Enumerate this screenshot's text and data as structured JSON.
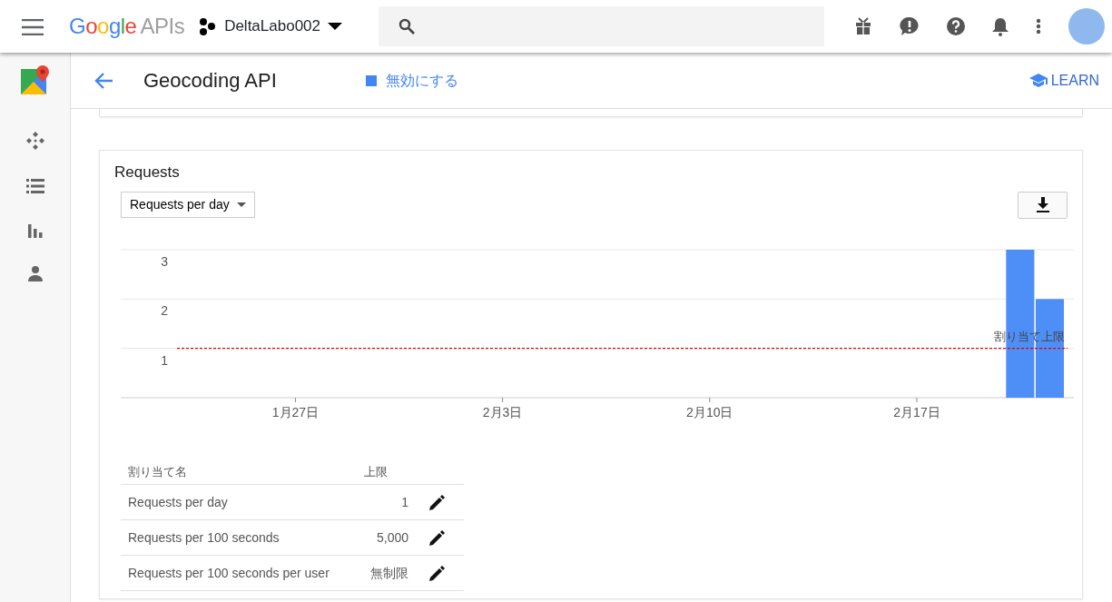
{
  "header": {
    "logo": "Google",
    "logo_suffix": "APIs",
    "project": "DeltaLabo002"
  },
  "subheader": {
    "title": "Geocoding API",
    "disable": "無効にする",
    "learn": "LEARN"
  },
  "requests_card": {
    "title": "Requests",
    "metric_select": "Requests per day",
    "chart_data": {
      "type": "bar",
      "categories": [
        null,
        null,
        null,
        null,
        "1月27日",
        null,
        null,
        null,
        null,
        null,
        null,
        "2月3日",
        null,
        null,
        null,
        null,
        null,
        null,
        "2月10日",
        null,
        null,
        null,
        null,
        null,
        null,
        "2月17日",
        null,
        null,
        null,
        null
      ],
      "series": [
        {
          "color": "#4e8ef7",
          "values": [
            0,
            0,
            0,
            0,
            0,
            0,
            0,
            0,
            0,
            0,
            0,
            0,
            0,
            0,
            0,
            0,
            0,
            0,
            0,
            0,
            0,
            0,
            0,
            0,
            0,
            0,
            0,
            0,
            3,
            2
          ]
        }
      ],
      "ylim": [
        0,
        3
      ],
      "yticks": [
        1,
        2,
        3
      ],
      "ref_lines": [
        {
          "axis": "y",
          "value": 1,
          "label": "割り当て上限"
        }
      ]
    },
    "quota_table": {
      "columns": [
        "割り当て名",
        "上限"
      ],
      "rows": [
        {
          "name": "Requests per day",
          "limit": "1"
        },
        {
          "name": "Requests per 100 seconds",
          "limit": "5,000"
        },
        {
          "name": "Requests per 100 seconds per user",
          "limit": "無制限"
        }
      ]
    }
  }
}
